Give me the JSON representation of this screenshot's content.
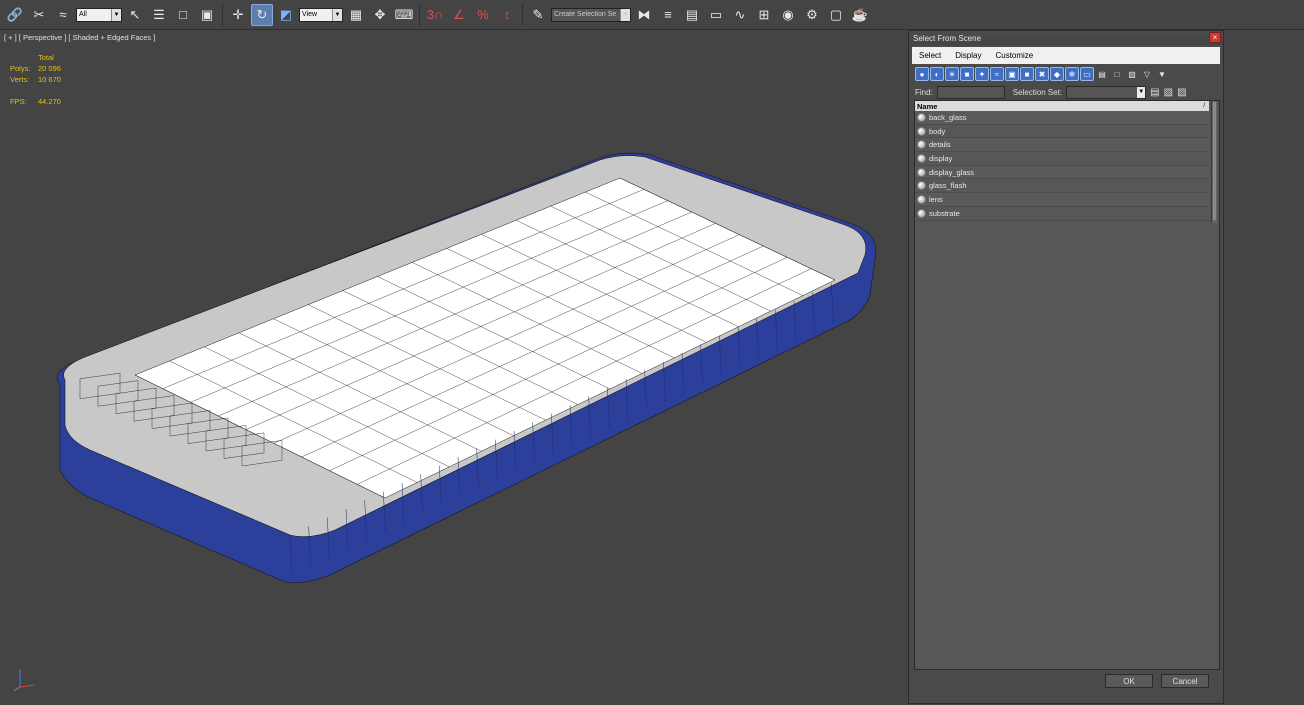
{
  "toolbar": {
    "filter_select": "All",
    "coord_select": "View",
    "named_selection_placeholder": "Create Selection Se",
    "icons": [
      "link-icon",
      "unlink-icon",
      "bind-space-warp-icon",
      "select-object-icon",
      "select-by-name-icon",
      "rect-selection-icon",
      "window-crossing-icon",
      "move-icon",
      "rotate-icon",
      "scale-icon",
      "pivot-icon",
      "manipulate-icon",
      "keyboard-shortcut-icon",
      "snap-3d-icon",
      "angle-snap-icon",
      "percent-snap-icon",
      "spinner-snap-icon",
      "edit-named-selection-icon",
      "mirror-icon",
      "align-icon",
      "layer-explorer-icon",
      "toggle-ribbon-icon",
      "curve-editor-icon",
      "schematic-view-icon",
      "material-editor-icon",
      "render-setup-icon",
      "rendered-frame-icon",
      "render-icon"
    ]
  },
  "viewport": {
    "label": "[ + ] [ Perspective ] [ Shaded + Edged Faces ]",
    "stats": {
      "header": "Total",
      "rows": [
        {
          "key": "Polys:",
          "value": "20 096"
        },
        {
          "key": "Verts:",
          "value": "10 670"
        }
      ],
      "fps_key": "FPS:",
      "fps_value": "44.270"
    },
    "model_colors": {
      "body": "#2c3f9a",
      "screen": "#ffffff",
      "wire": "#1a1a1a",
      "back_face": "#c8c8c8"
    }
  },
  "dialog": {
    "title": "Select From Scene",
    "close_label": "×",
    "menu": [
      "Select",
      "Display",
      "Customize"
    ],
    "find_label": "Find:",
    "find_value": "",
    "selection_set_label": "Selection Set:",
    "selection_set_value": "",
    "list_header": "Name",
    "list_sort_glyph": "/",
    "objects": [
      "back_glass",
      "body",
      "details",
      "display",
      "display_glass",
      "glass_flash",
      "lens",
      "substrate"
    ],
    "ok_label": "OK",
    "cancel_label": "Cancel"
  }
}
